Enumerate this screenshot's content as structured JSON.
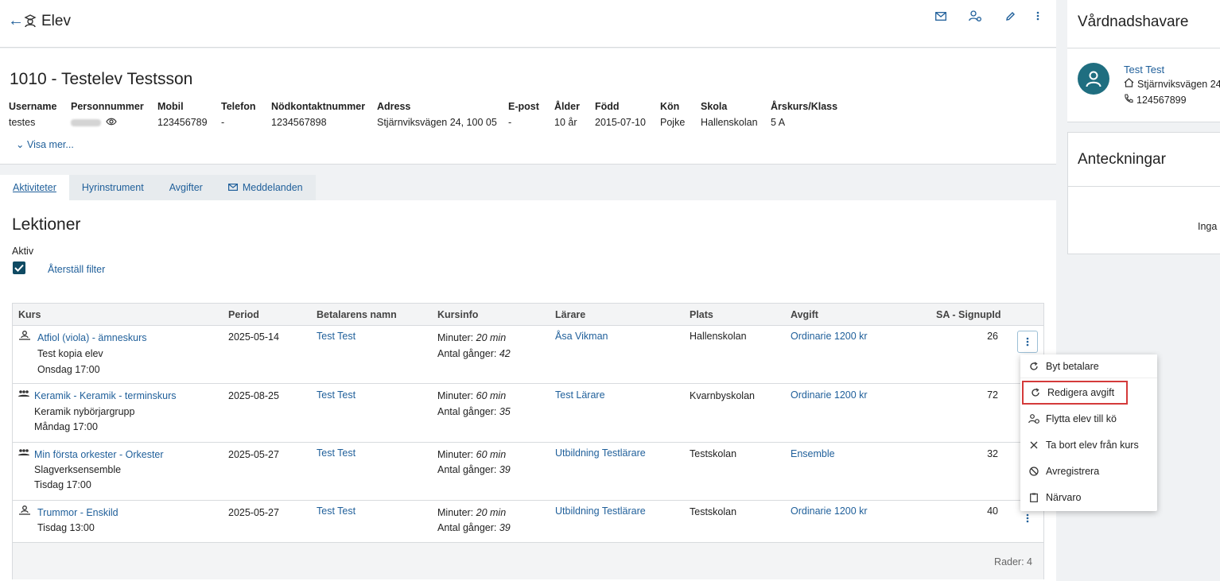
{
  "header": {
    "title": "Elev"
  },
  "student": {
    "name": "1010 - Testelev Testsson",
    "fields": [
      {
        "label": "Username",
        "value": "testes"
      },
      {
        "label": "Personnummer",
        "value": ""
      },
      {
        "label": "Mobil",
        "value": "123456789"
      },
      {
        "label": "Telefon",
        "value": "-"
      },
      {
        "label": "Nödkontaktnummer",
        "value": "1234567898"
      },
      {
        "label": "Adress",
        "value": "Stjärnviksvägen 24, 100 05"
      },
      {
        "label": "E-post",
        "value": "-"
      },
      {
        "label": "Ålder",
        "value": "10 år"
      },
      {
        "label": "Född",
        "value": "2015-07-10"
      },
      {
        "label": "Kön",
        "value": "Pojke"
      },
      {
        "label": "Skola",
        "value": "Hallenskolan"
      },
      {
        "label": "Årskurs/Klass",
        "value": "5 A"
      }
    ],
    "show_more": "Visa mer..."
  },
  "tabs": [
    "Aktiviteter",
    "Hyrinstrument",
    "Avgifter",
    "Meddelanden"
  ],
  "lessons": {
    "title": "Lektioner",
    "filter_label": "Aktiv",
    "reset_filter": "Återställ filter",
    "columns": [
      "Kurs",
      "Period",
      "Betalarens namn",
      "Kursinfo",
      "Lärare",
      "Plats",
      "Avgift",
      "SA - SignupId"
    ],
    "rows": [
      {
        "course": "Atfiol (viola) - ämneskurs",
        "sub1": "Test kopia elev",
        "sub2": "Onsdag 17:00",
        "period": "2025-05-14",
        "payer": "Test Test",
        "min_label": "Minuter:",
        "minutes": "20 min",
        "times_label": "Antal gånger:",
        "times": "42",
        "teacher": "Åsa Vikman",
        "place": "Hallenskolan",
        "fee": "Ordinarie 1200 kr",
        "signup": "26"
      },
      {
        "course": "Keramik - Keramik - terminskurs",
        "sub1": "Keramik nybörjargrupp",
        "sub2": "Måndag 17:00",
        "period": "2025-08-25",
        "payer": "Test Test",
        "min_label": "Minuter:",
        "minutes": "60 min",
        "times_label": "Antal gånger:",
        "times": "35",
        "teacher": "Test Lärare",
        "place": "Kvarnbyskolan",
        "fee": "Ordinarie 1200 kr",
        "signup": "72"
      },
      {
        "course": "Min första orkester - Orkester",
        "sub1": "Slagverksensemble",
        "sub2": "Tisdag 17:00",
        "period": "2025-05-27",
        "payer": "Test Test",
        "min_label": "Minuter:",
        "minutes": "60 min",
        "times_label": "Antal gånger:",
        "times": "39",
        "teacher": "Utbildning Testlärare",
        "place": "Testskolan",
        "fee": "Ensemble",
        "signup": "32"
      },
      {
        "course": "Trummor - Enskild",
        "sub1": "Tisdag 13:00",
        "sub2": "",
        "period": "2025-05-27",
        "payer": "Test Test",
        "min_label": "Minuter:",
        "minutes": "20 min",
        "times_label": "Antal gånger:",
        "times": "39",
        "teacher": "Utbildning Testlärare",
        "place": "Testskolan",
        "fee": "Ordinarie 1200 kr",
        "signup": "40"
      }
    ],
    "rows_count": "Rader: 4"
  },
  "context_menu": {
    "items": [
      "Byt betalare",
      "Redigera avgift",
      "Flytta elev till kö",
      "Ta bort elev från kurs",
      "Avregistrera",
      "Närvaro"
    ]
  },
  "guardian": {
    "title": "Vårdnadshavare",
    "name": "Test Test",
    "address": "Stjärnviksvägen 24",
    "phone": "124567899"
  },
  "notes": {
    "title": "Anteckningar",
    "empty": "Inga a"
  },
  "colors": {
    "accent": "#1f5f9a",
    "highlight": "#d43a3a",
    "checkbox": "#0f4a63",
    "avatar": "#1f6e80"
  }
}
